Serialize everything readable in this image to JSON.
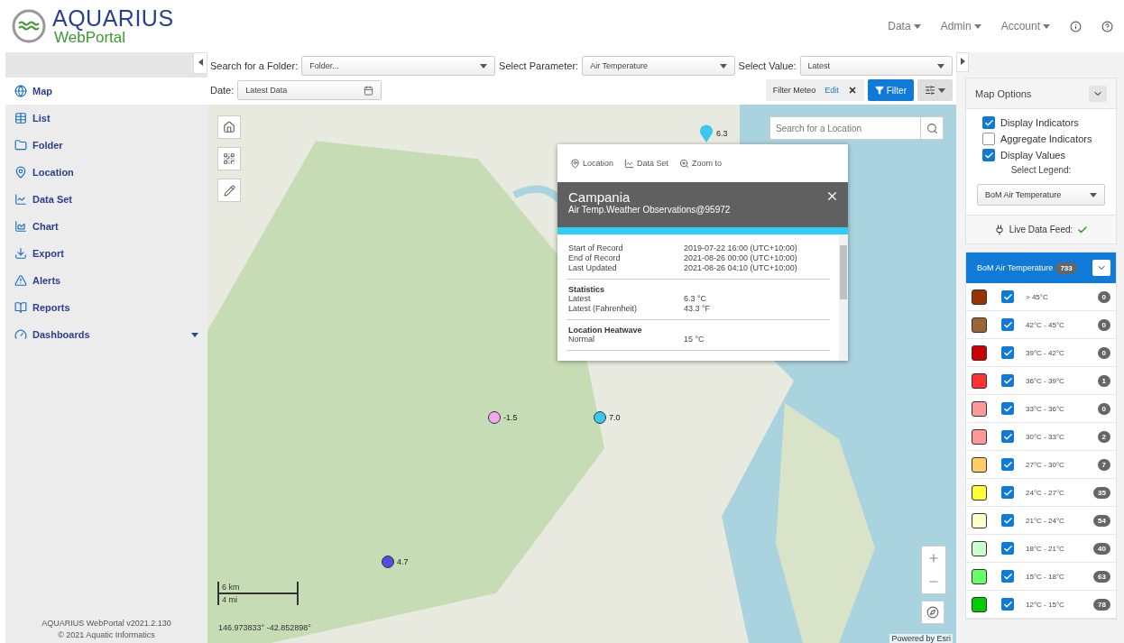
{
  "header": {
    "logo_title": "AQUARIUS",
    "logo_subtitle": "WebPortal",
    "nav": [
      {
        "label": "Data",
        "kind": "menu"
      },
      {
        "label": "Admin",
        "kind": "menu"
      },
      {
        "label": "Account",
        "kind": "menu"
      },
      {
        "kind": "info"
      },
      {
        "kind": "help"
      }
    ]
  },
  "sidebar": {
    "items": [
      {
        "label": "Map",
        "selected": true,
        "expandable": false
      },
      {
        "label": "List",
        "selected": false,
        "expandable": false
      },
      {
        "label": "Folder",
        "selected": false,
        "expandable": false
      },
      {
        "label": "Location",
        "selected": false,
        "expandable": false
      },
      {
        "label": "Data Set",
        "selected": false,
        "expandable": false
      },
      {
        "label": "Chart",
        "selected": false,
        "expandable": false
      },
      {
        "label": "Export",
        "selected": false,
        "expandable": false
      },
      {
        "label": "Alerts",
        "selected": false,
        "expandable": false
      },
      {
        "label": "Reports",
        "selected": false,
        "expandable": false
      },
      {
        "label": "Dashboards",
        "selected": false,
        "expandable": true
      }
    ],
    "footer": [
      "AQUARIUS WebPortal v2021.2.130",
      "© 2021 Aquatic Informatics"
    ]
  },
  "toolbar": {
    "selects": [
      {
        "label": "Search for a Folder:",
        "value": "Folder..."
      },
      {
        "label": "Select Parameter:",
        "value": "Air Temperature"
      },
      {
        "label": "Select Value:",
        "value": "Latest"
      }
    ],
    "date": {
      "label": "Date:",
      "value": "Latest Data"
    },
    "filter_tag": {
      "label": "Filter Meteo",
      "edit": "Edit"
    },
    "filter_button": "Filter"
  },
  "map": {
    "search": {
      "placeholder": "Search for a Location"
    },
    "markers": [
      {
        "kind": "pin",
        "color": "#3cc8ee",
        "value": "6.3"
      },
      {
        "kind": "dot",
        "color": "#f4a6f0",
        "value": "-1.5"
      },
      {
        "kind": "dot",
        "color": "#3cc8ee",
        "value": "7.0"
      },
      {
        "kind": "dot",
        "color": "#4f4fe0",
        "value": "4.7"
      }
    ],
    "scale": [
      "6 km",
      "4 mi"
    ],
    "coordinates": "146.973833° -42.852898°",
    "attribution": "Powered by Esri",
    "popup": {
      "actions": [
        "Location",
        "Data Set",
        "Zoom to"
      ],
      "title": "Campania",
      "subtitle": "Air Temp.Weather Observations@95972",
      "sections": [
        {
          "rows": [
            [
              "Start of Record",
              "2019-07-22 16:00 (UTC+10:00)"
            ],
            [
              "End of Record",
              "2021-08-26 00:00 (UTC+10:00)"
            ],
            [
              "Last Updated",
              "2021-08-26 04:10 (UTC+10:00)"
            ]
          ]
        },
        {
          "heading": "Statistics",
          "rows": [
            [
              "Latest",
              "6.3 °C"
            ],
            [
              "Latest (Fahrenheit)",
              "43.3 °F"
            ]
          ]
        },
        {
          "heading": "Location Heatwave",
          "rows": [
            [
              "Normal",
              "15 °C"
            ]
          ]
        }
      ]
    }
  },
  "map_options": {
    "title": "Map Options",
    "options": [
      {
        "label": "Display Indicators",
        "checked": true
      },
      {
        "label": "Aggregate Indicators",
        "checked": false
      },
      {
        "label": "Display Values",
        "checked": true
      }
    ],
    "legend_label": "Select Legend:",
    "legend_value": "BoM Air Temperature",
    "live_feed": "Live Data Feed:",
    "live": true
  },
  "legend": {
    "title": "BoM Air Temperature",
    "count": "733",
    "rows": [
      {
        "color": "#993300",
        "checked": true,
        "label": "> 45°C",
        "count": "0"
      },
      {
        "color": "#996633",
        "checked": true,
        "label": "42°C - 45°C",
        "count": "0"
      },
      {
        "color": "#cc0000",
        "checked": true,
        "label": "39°C - 42°C",
        "count": "0"
      },
      {
        "color": "#ff3333",
        "checked": true,
        "label": "36°C - 39°C",
        "count": "1"
      },
      {
        "color": "#ff9999",
        "checked": true,
        "label": "33°C - 36°C",
        "count": "0"
      },
      {
        "color": "#ff9999",
        "checked": true,
        "label": "30°C - 33°C",
        "count": "2"
      },
      {
        "color": "#ffcc66",
        "checked": true,
        "label": "27°C - 30°C",
        "count": "7"
      },
      {
        "color": "#ffff33",
        "checked": true,
        "label": "24°C - 27°C",
        "count": "35"
      },
      {
        "color": "#ffffcc",
        "checked": true,
        "label": "21°C - 24°C",
        "count": "54"
      },
      {
        "color": "#ccffcc",
        "checked": true,
        "label": "18°C - 21°C",
        "count": "40"
      },
      {
        "color": "#66ff66",
        "checked": true,
        "label": "15°C - 18°C",
        "count": "63"
      },
      {
        "color": "#00cc00",
        "checked": true,
        "label": "12°C - 15°C",
        "count": "78"
      }
    ]
  }
}
